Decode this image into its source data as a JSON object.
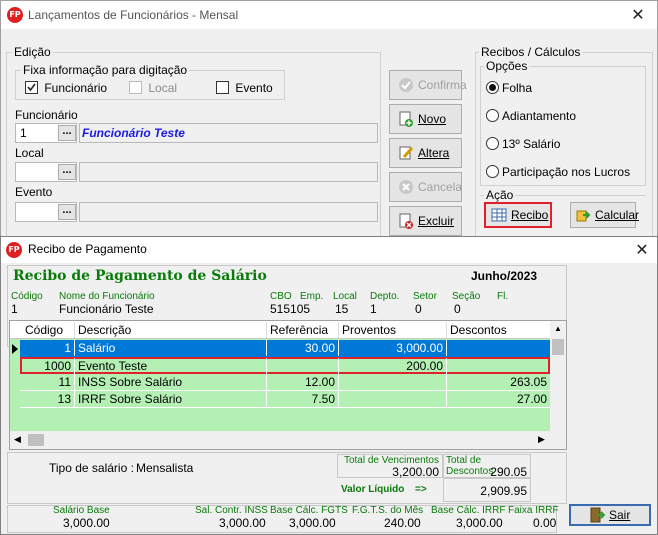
{
  "main_window": {
    "title": "Lançamentos de Funcionários - Mensal",
    "edicao": {
      "group_label": "Edição",
      "fixa_label": "Fixa informação para digitação",
      "checks": [
        {
          "label": "Funcionário",
          "checked": true,
          "enabled": true
        },
        {
          "label": "Local",
          "checked": false,
          "enabled": false
        },
        {
          "label": "Evento",
          "checked": false,
          "enabled": true
        }
      ],
      "funcionario_label": "Funcionário",
      "funcionario_code": "1",
      "funcionario_name": "Funcionário Teste",
      "local_label": "Local",
      "evento_label": "Evento",
      "dots": "..."
    },
    "buttons": {
      "confirma": "Confirma",
      "novo": "Novo",
      "altera": "Altera",
      "cancela": "Cancela",
      "excluir": "Excluir"
    },
    "recibos": {
      "group_label": "Recibos / Cálculos",
      "opcoes_label": "Opções",
      "options": [
        {
          "label": "Folha",
          "selected": true
        },
        {
          "label": "Adiantamento",
          "selected": false
        },
        {
          "label": "13º Salário",
          "selected": false
        },
        {
          "label": "Participação nos Lucros",
          "selected": false
        }
      ],
      "acao_label": "Ação",
      "recibo_button": "Recibo",
      "calcular_button": "Calcular"
    }
  },
  "recibo_window": {
    "title": "Recibo de Pagamento",
    "heading": "Recibo de Pagamento de Salário",
    "period": "Junho/2023",
    "employee": {
      "codigo_label": "Código",
      "codigo": "1",
      "nome_label": "Nome do Funcionário",
      "nome": "Funcionário Teste",
      "cbo_label": "CBO",
      "cbo": "515105",
      "emp_label": "Emp.",
      "emp": "15",
      "local_label": "Local",
      "local": "1",
      "depto_label": "Depto.",
      "depto": "0",
      "setor_label": "Setor",
      "setor": "0",
      "secao_label": "Seção",
      "secao": "0",
      "fl_label": "Fl."
    },
    "table": {
      "columns": [
        "Código",
        "Descrição",
        "Referência",
        "Proventos",
        "Descontos"
      ],
      "rows": [
        {
          "codigo": "1",
          "descricao": "Salário",
          "referencia": "30.00",
          "proventos": "3,000.00",
          "descontos": "",
          "selected": true
        },
        {
          "codigo": "1000",
          "descricao": "Evento Teste",
          "referencia": "",
          "proventos": "200.00",
          "descontos": "",
          "highlighted": true
        },
        {
          "codigo": "11",
          "descricao": "INSS Sobre Salário",
          "referencia": "12.00",
          "proventos": "",
          "descontos": "263.05"
        },
        {
          "codigo": "13",
          "descricao": "IRRF Sobre Salário",
          "referencia": "7.50",
          "proventos": "",
          "descontos": "27.00"
        }
      ]
    },
    "tipo_salario_label": "Tipo de salário :",
    "tipo_salario": "Mensalista",
    "total_vencimentos_label": "Total de Vencimentos",
    "total_vencimentos": "3,200.00",
    "total_descontos_label": "Total de Descontos",
    "total_descontos": "290.05",
    "valor_liquido_label": "Valor Líquido",
    "valor_liquido_arrow": "=>",
    "valor_liquido": "2,909.95",
    "footer": [
      {
        "label": "Salário Base",
        "value": "3,000.00"
      },
      {
        "label": "Sal. Contr. INSS",
        "value": "3,000.00"
      },
      {
        "label": "Base Cálc. FGTS",
        "value": "3,000.00"
      },
      {
        "label": "F.G.T.S. do Mês",
        "value": "240.00"
      },
      {
        "label": "Base Cálc. IRRF",
        "value": "3,000.00"
      },
      {
        "label": "Faixa IRRF",
        "value": "0.00"
      }
    ],
    "sair_button": "Sair"
  },
  "colors": {
    "accent_green": "#0a7a0a",
    "selection_blue": "#0078d7",
    "row_green": "#b4f0b4",
    "highlight_red": "#e0202a"
  }
}
